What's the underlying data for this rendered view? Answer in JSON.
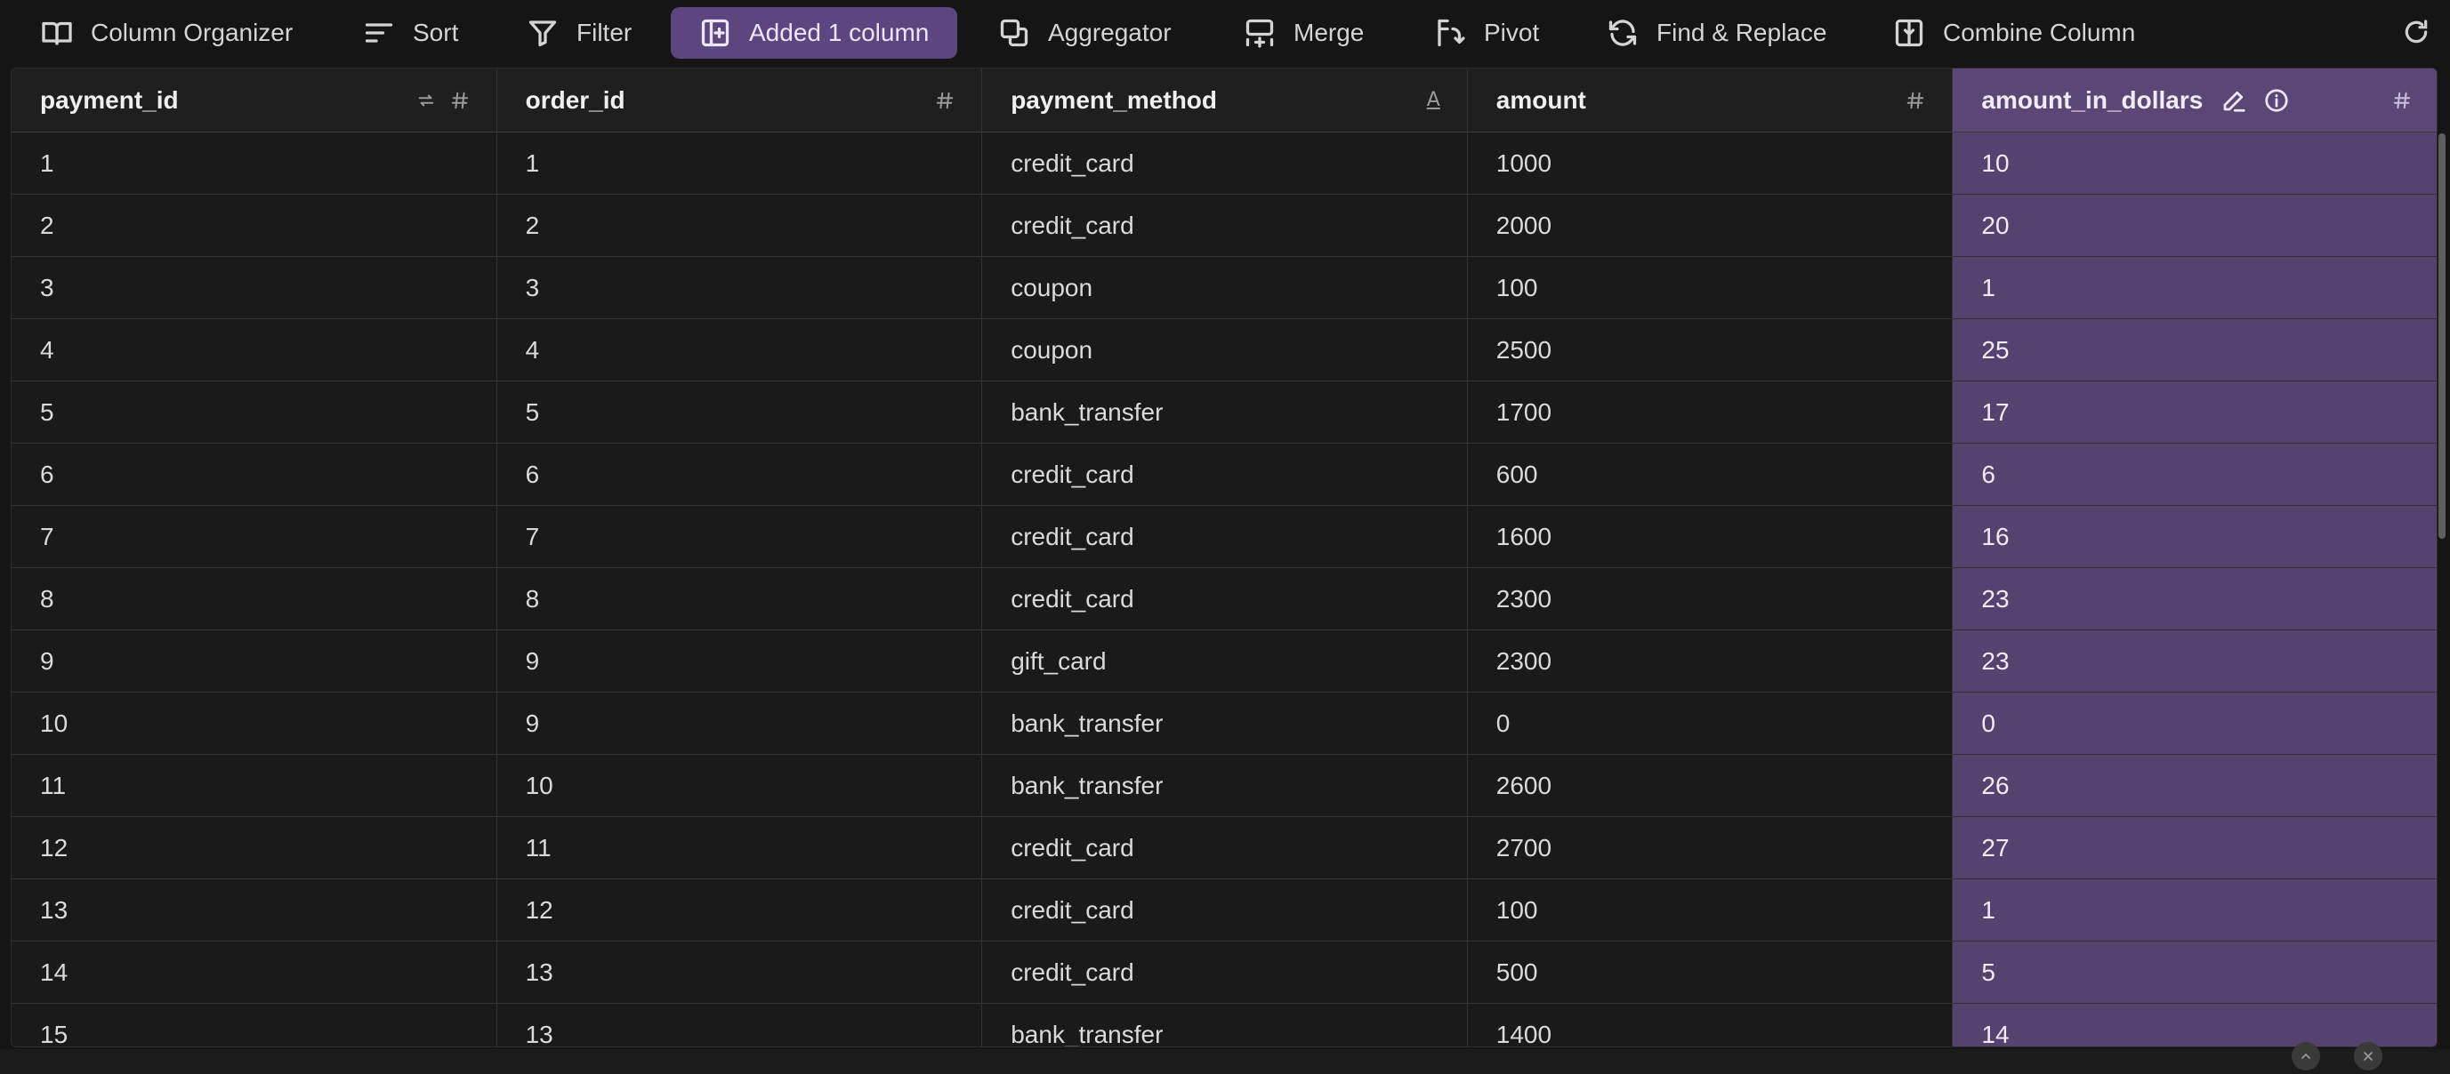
{
  "toolbar": {
    "items": [
      {
        "label": "Column Organizer",
        "icon": "book-open-icon"
      },
      {
        "label": "Sort",
        "icon": "sort-lines-icon"
      },
      {
        "label": "Filter",
        "icon": "filter-funnel-icon"
      },
      {
        "label": "Added 1 column",
        "icon": "add-column-icon",
        "active": true
      },
      {
        "label": "Aggregator",
        "icon": "aggregator-icon"
      },
      {
        "label": "Merge",
        "icon": "merge-icon"
      },
      {
        "label": "Pivot",
        "icon": "pivot-icon"
      },
      {
        "label": "Find & Replace",
        "icon": "find-replace-icon"
      },
      {
        "label": "Combine Column",
        "icon": "combine-column-icon"
      }
    ],
    "refresh_icon": "refresh-icon"
  },
  "colors": {
    "background": "#151515",
    "accent_purple": "#5b4680",
    "added_column": "#54426f"
  },
  "table": {
    "columns": [
      {
        "name": "payment_id",
        "type": "number",
        "key_icon": true
      },
      {
        "name": "order_id",
        "type": "number"
      },
      {
        "name": "payment_method",
        "type": "text"
      },
      {
        "name": "amount",
        "type": "number"
      },
      {
        "name": "amount_in_dollars",
        "type": "number",
        "added": true
      }
    ],
    "rows": [
      [
        "1",
        "1",
        "credit_card",
        "1000",
        "10"
      ],
      [
        "2",
        "2",
        "credit_card",
        "2000",
        "20"
      ],
      [
        "3",
        "3",
        "coupon",
        "100",
        "1"
      ],
      [
        "4",
        "4",
        "coupon",
        "2500",
        "25"
      ],
      [
        "5",
        "5",
        "bank_transfer",
        "1700",
        "17"
      ],
      [
        "6",
        "6",
        "credit_card",
        "600",
        "6"
      ],
      [
        "7",
        "7",
        "credit_card",
        "1600",
        "16"
      ],
      [
        "8",
        "8",
        "credit_card",
        "2300",
        "23"
      ],
      [
        "9",
        "9",
        "gift_card",
        "2300",
        "23"
      ],
      [
        "10",
        "9",
        "bank_transfer",
        "0",
        "0"
      ],
      [
        "11",
        "10",
        "bank_transfer",
        "2600",
        "26"
      ],
      [
        "12",
        "11",
        "credit_card",
        "2700",
        "27"
      ],
      [
        "13",
        "12",
        "credit_card",
        "100",
        "1"
      ],
      [
        "14",
        "13",
        "credit_card",
        "500",
        "5"
      ],
      [
        "15",
        "13",
        "bank_transfer",
        "1400",
        "14"
      ]
    ]
  }
}
